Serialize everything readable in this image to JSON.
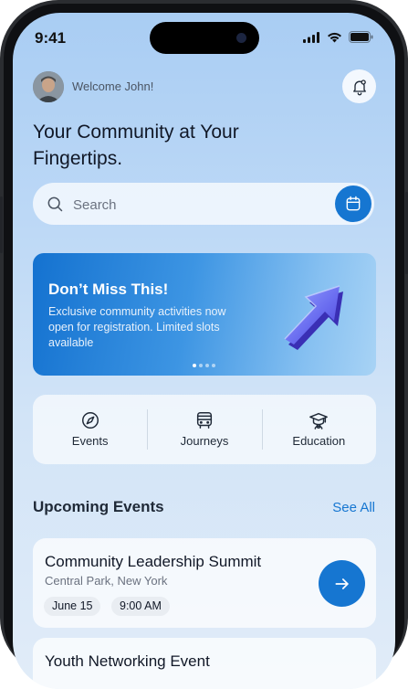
{
  "status": {
    "time": "9:41"
  },
  "header": {
    "welcome": "Welcome John!",
    "headline": "Your Community at Your Fingertips."
  },
  "search": {
    "placeholder": "Search"
  },
  "banner": {
    "title": "Don’t Miss This!",
    "text": "Exclusive community activities now open for registration. Limited slots available",
    "active_slide": 1,
    "slide_count": 4
  },
  "categories": [
    {
      "label": "Events",
      "icon": "compass-icon"
    },
    {
      "label": "Journeys",
      "icon": "bus-icon"
    },
    {
      "label": "Education",
      "icon": "graduation-cap-icon"
    }
  ],
  "upcoming": {
    "title": "Upcoming Events",
    "see_all": "See All",
    "events": [
      {
        "title": "Community Leadership Summit",
        "location": "Central Park, New York",
        "date": "June 15",
        "time": "9:00 AM"
      },
      {
        "title": "Youth Networking Event"
      }
    ]
  },
  "colors": {
    "accent": "#1676d1",
    "text": "#111827"
  }
}
